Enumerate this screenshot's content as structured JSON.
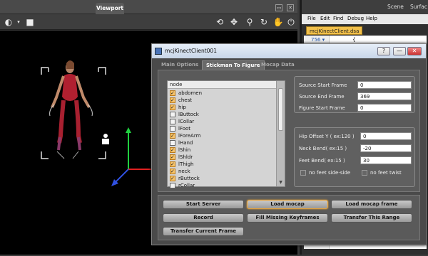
{
  "viewport": {
    "tab_label": "Viewport",
    "toolbar_icons": [
      "sphere-icon",
      "square-icon",
      "rotate-camera-icon",
      "move-icon",
      "zoom-icon",
      "orbit-icon",
      "pan-icon",
      "power-icon"
    ]
  },
  "right_panel": {
    "tabs": [
      "Scene",
      "Surfac"
    ],
    "menu": [
      "File",
      "Edit",
      "Find",
      "Debug",
      "Help"
    ],
    "file_tab": "mcjKinectClient.dsa",
    "line_number": "756 ▾",
    "code_text": "{"
  },
  "dialog": {
    "title": "mcjKinectClient001",
    "help_btn": "?",
    "tabs": [
      "Main Options",
      "Stickman To Figure",
      "Mocap Data"
    ],
    "active_tab": 1,
    "node_list": {
      "header": "node",
      "items": [
        {
          "label": "abdomen",
          "checked": true
        },
        {
          "label": "chest",
          "checked": true
        },
        {
          "label": "hip",
          "checked": true
        },
        {
          "label": "lButtock",
          "checked": false
        },
        {
          "label": "lCollar",
          "checked": false
        },
        {
          "label": "lFoot",
          "checked": false
        },
        {
          "label": "lForeArm",
          "checked": true
        },
        {
          "label": "lHand",
          "checked": false
        },
        {
          "label": "lShin",
          "checked": true
        },
        {
          "label": "lShldr",
          "checked": true
        },
        {
          "label": "lThigh",
          "checked": true
        },
        {
          "label": "neck",
          "checked": true
        },
        {
          "label": "rButtock",
          "checked": true
        },
        {
          "label": "rCollar",
          "checked": false
        }
      ]
    },
    "frames": {
      "source_start_label": "Source Start Frame",
      "source_start_value": "0",
      "source_end_label": "Source End Frame",
      "source_end_value": "369",
      "figure_start_label": "Figure Start Frame",
      "figure_start_value": "0"
    },
    "offsets": {
      "hip_offset_label": "Hip Offset Y ( ex:120 )",
      "hip_offset_value": "0",
      "neck_bend_label": "Neck Bend( ex:15 )",
      "neck_bend_value": "-20",
      "feet_bend_label": "Feet Bend( ex:15 )",
      "feet_bend_value": "30",
      "no_side_label": "no feet side-side",
      "no_twist_label": "no feet twist"
    },
    "buttons": {
      "start_server": "Start Server",
      "load_mocap": "Load mocap",
      "load_mocap_frame": "Load mocap frame",
      "record": "Record",
      "fill_missing": "Fill Missing Keyframes",
      "transfer_range": "Transfer This Range",
      "transfer_current": "Transfer Current Frame"
    }
  },
  "colors": {
    "accent_orange": "#f6c36a",
    "figure_suit": "#b02030",
    "axis_red": "#e02020",
    "axis_green": "#20d040",
    "axis_blue": "#3050e0"
  }
}
